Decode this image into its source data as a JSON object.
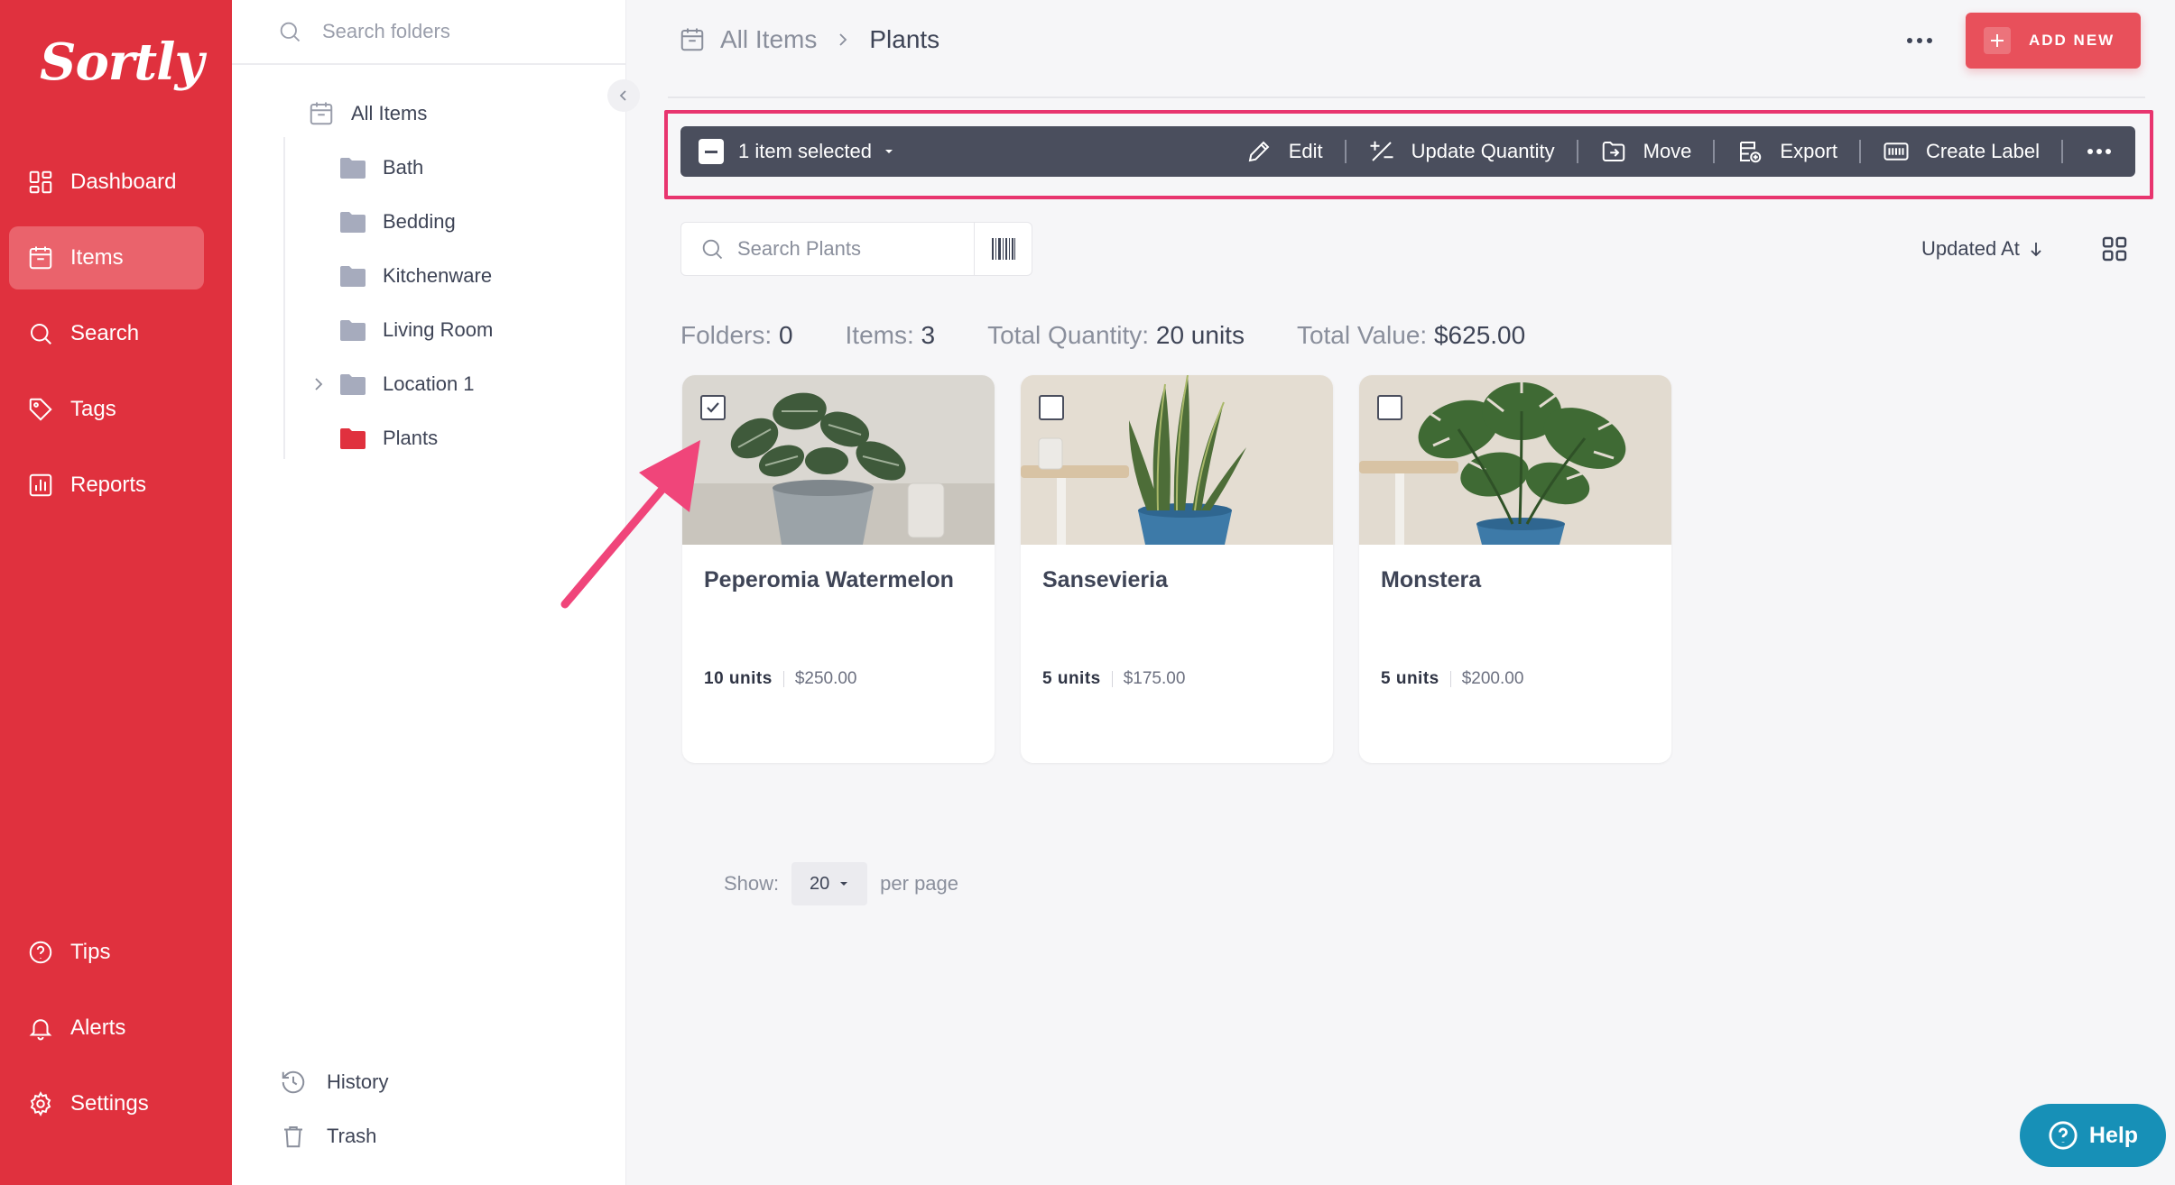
{
  "app": {
    "logo": "Sortly"
  },
  "nav": {
    "items": [
      {
        "label": "Dashboard",
        "icon": "dashboard-icon",
        "active": false
      },
      {
        "label": "Items",
        "icon": "items-icon",
        "active": true
      },
      {
        "label": "Search",
        "icon": "search-icon",
        "active": false
      },
      {
        "label": "Tags",
        "icon": "tag-icon",
        "active": false
      },
      {
        "label": "Reports",
        "icon": "reports-icon",
        "active": false
      }
    ],
    "bottom": [
      {
        "label": "Tips",
        "icon": "help-circle-icon"
      },
      {
        "label": "Alerts",
        "icon": "bell-icon"
      },
      {
        "label": "Settings",
        "icon": "gear-icon"
      }
    ]
  },
  "folders": {
    "search_placeholder": "Search folders",
    "root": "All Items",
    "items": [
      "Bath",
      "Bedding",
      "Kitchenware",
      "Living Room",
      "Location 1",
      "Plants"
    ],
    "active": "Plants",
    "footer": [
      "History",
      "Trash"
    ]
  },
  "header": {
    "breadcrumb_root": "All Items",
    "breadcrumb_current": "Plants",
    "add_new": "ADD NEW"
  },
  "toolbar": {
    "selection": "1 item selected",
    "actions": [
      "Edit",
      "Update Quantity",
      "Move",
      "Export",
      "Create Label"
    ]
  },
  "search": {
    "placeholder": "Search Plants"
  },
  "sort": {
    "label": "Updated At"
  },
  "stats": {
    "folders_label": "Folders:",
    "folders_value": "0",
    "items_label": "Items:",
    "items_value": "3",
    "quantity_label": "Total Quantity:",
    "quantity_value": "20 units",
    "value_label": "Total Value:",
    "value_value": "$625.00"
  },
  "cards": [
    {
      "name": "Peperomia Watermelon",
      "qty": "10 units",
      "price": "$250.00",
      "checked": true
    },
    {
      "name": "Sansevieria",
      "qty": "5 units",
      "price": "$175.00",
      "checked": false
    },
    {
      "name": "Monstera",
      "qty": "5 units",
      "price": "$200.00",
      "checked": false
    }
  ],
  "pagination": {
    "show_label": "Show:",
    "per_page_value": "20",
    "per_page_label": "per page"
  },
  "help": {
    "label": "Help"
  },
  "colors": {
    "brand": "#e0313e",
    "toolbar": "#4a4e5d",
    "highlight": "#e8356f",
    "help": "#1790b7"
  }
}
